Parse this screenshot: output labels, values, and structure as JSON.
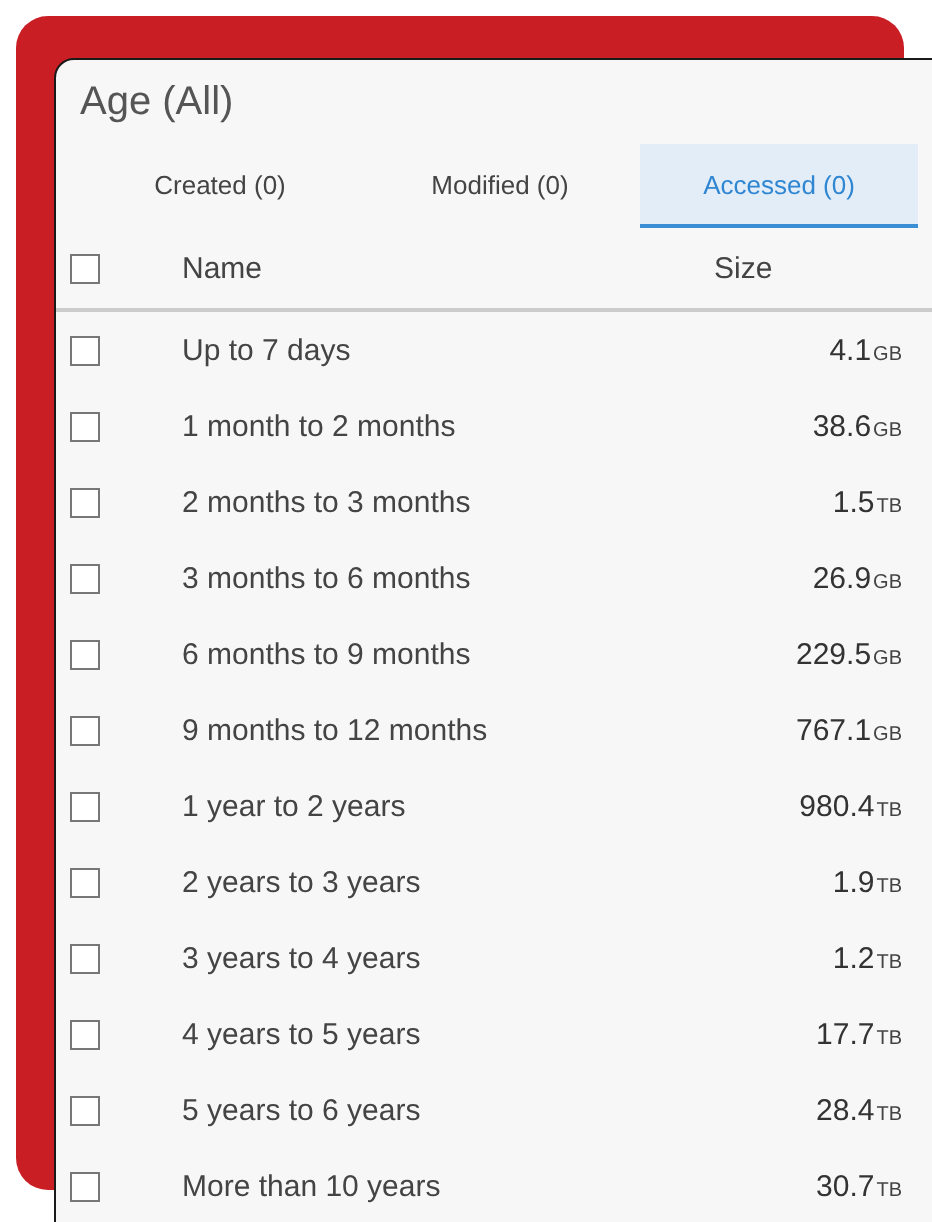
{
  "title": "Age (All)",
  "tabs": [
    {
      "label": "Created (0)",
      "selected": false
    },
    {
      "label": "Modified (0)",
      "selected": false
    },
    {
      "label": "Accessed (0)",
      "selected": true
    }
  ],
  "columns": [
    "Name",
    "Size"
  ],
  "header_checked": false,
  "rows": [
    {
      "name": "Up to 7 days",
      "size": "4.1",
      "unit": "GB",
      "checked": false
    },
    {
      "name": "1 month to 2 months",
      "size": "38.6",
      "unit": "GB",
      "checked": false
    },
    {
      "name": "2 months to 3 months",
      "size": "1.5",
      "unit": "TB",
      "checked": false
    },
    {
      "name": "3 months to 6 months",
      "size": "26.9",
      "unit": "GB",
      "checked": false
    },
    {
      "name": "6 months to 9 months",
      "size": "229.5",
      "unit": "GB",
      "checked": false
    },
    {
      "name": "9 months to 12 months",
      "size": "767.1",
      "unit": "GB",
      "checked": false
    },
    {
      "name": "1 year to 2 years",
      "size": "980.4",
      "unit": "TB",
      "checked": false
    },
    {
      "name": "2 years to 3 years",
      "size": "1.9",
      "unit": "TB",
      "checked": false
    },
    {
      "name": "3 years to 4 years",
      "size": "1.2",
      "unit": "TB",
      "checked": false
    },
    {
      "name": "4 years to 5 years",
      "size": "17.7",
      "unit": "TB",
      "checked": false
    },
    {
      "name": "5 years to 6 years",
      "size": "28.4",
      "unit": "TB",
      "checked": false
    },
    {
      "name": "More than 10 years",
      "size": "30.7",
      "unit": "TB",
      "checked": false
    }
  ]
}
